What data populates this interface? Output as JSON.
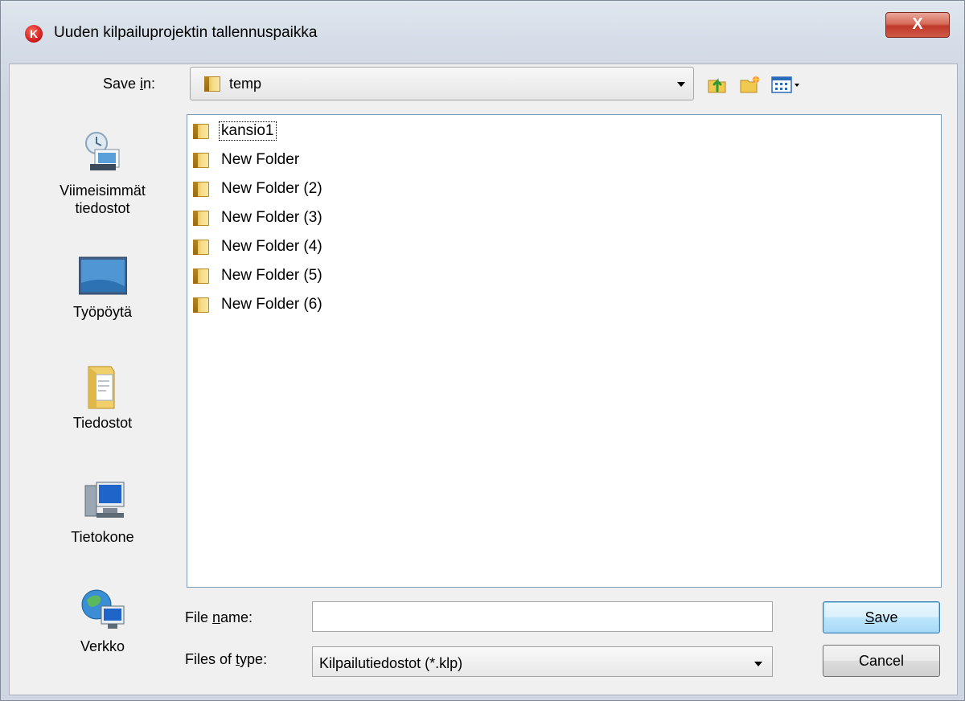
{
  "window": {
    "title": "Uuden kilpailuprojektin tallennuspaikka",
    "app_icon_letter": "K",
    "close_glyph": "X"
  },
  "lookin": {
    "label_pre": "Save ",
    "label_mnemonic": "i",
    "label_post": "n:",
    "value": "temp"
  },
  "toolbar": {
    "up_icon": "up-one-level-icon",
    "new_folder_icon": "new-folder-icon",
    "view_menu_icon": "view-menu-icon"
  },
  "places": [
    {
      "label": "Viimeisimmät\ntiedostot",
      "icon": "recent-files-icon"
    },
    {
      "label": "Työpöytä",
      "icon": "desktop-icon"
    },
    {
      "label": "Tiedostot",
      "icon": "documents-icon"
    },
    {
      "label": "Tietokone",
      "icon": "computer-icon"
    },
    {
      "label": "Verkko",
      "icon": "network-icon"
    }
  ],
  "files": [
    "kansio1",
    "New Folder",
    "New Folder (2)",
    "New Folder (3)",
    "New Folder (4)",
    "New Folder (5)",
    "New Folder (6)"
  ],
  "filename": {
    "label_pre": "File ",
    "label_mnemonic": "n",
    "label_post": "ame:",
    "value": ""
  },
  "filetype": {
    "label_pre": "Files of ",
    "label_mnemonic": "t",
    "label_post": "ype:",
    "value": "Kilpailutiedostot (*.klp)"
  },
  "buttons": {
    "save_mnemonic": "S",
    "save_rest": "ave",
    "cancel": "Cancel"
  },
  "colors": {
    "default_button": "#bee6fd",
    "close_button": "#c0392b",
    "folder": "#f6dd8c"
  }
}
